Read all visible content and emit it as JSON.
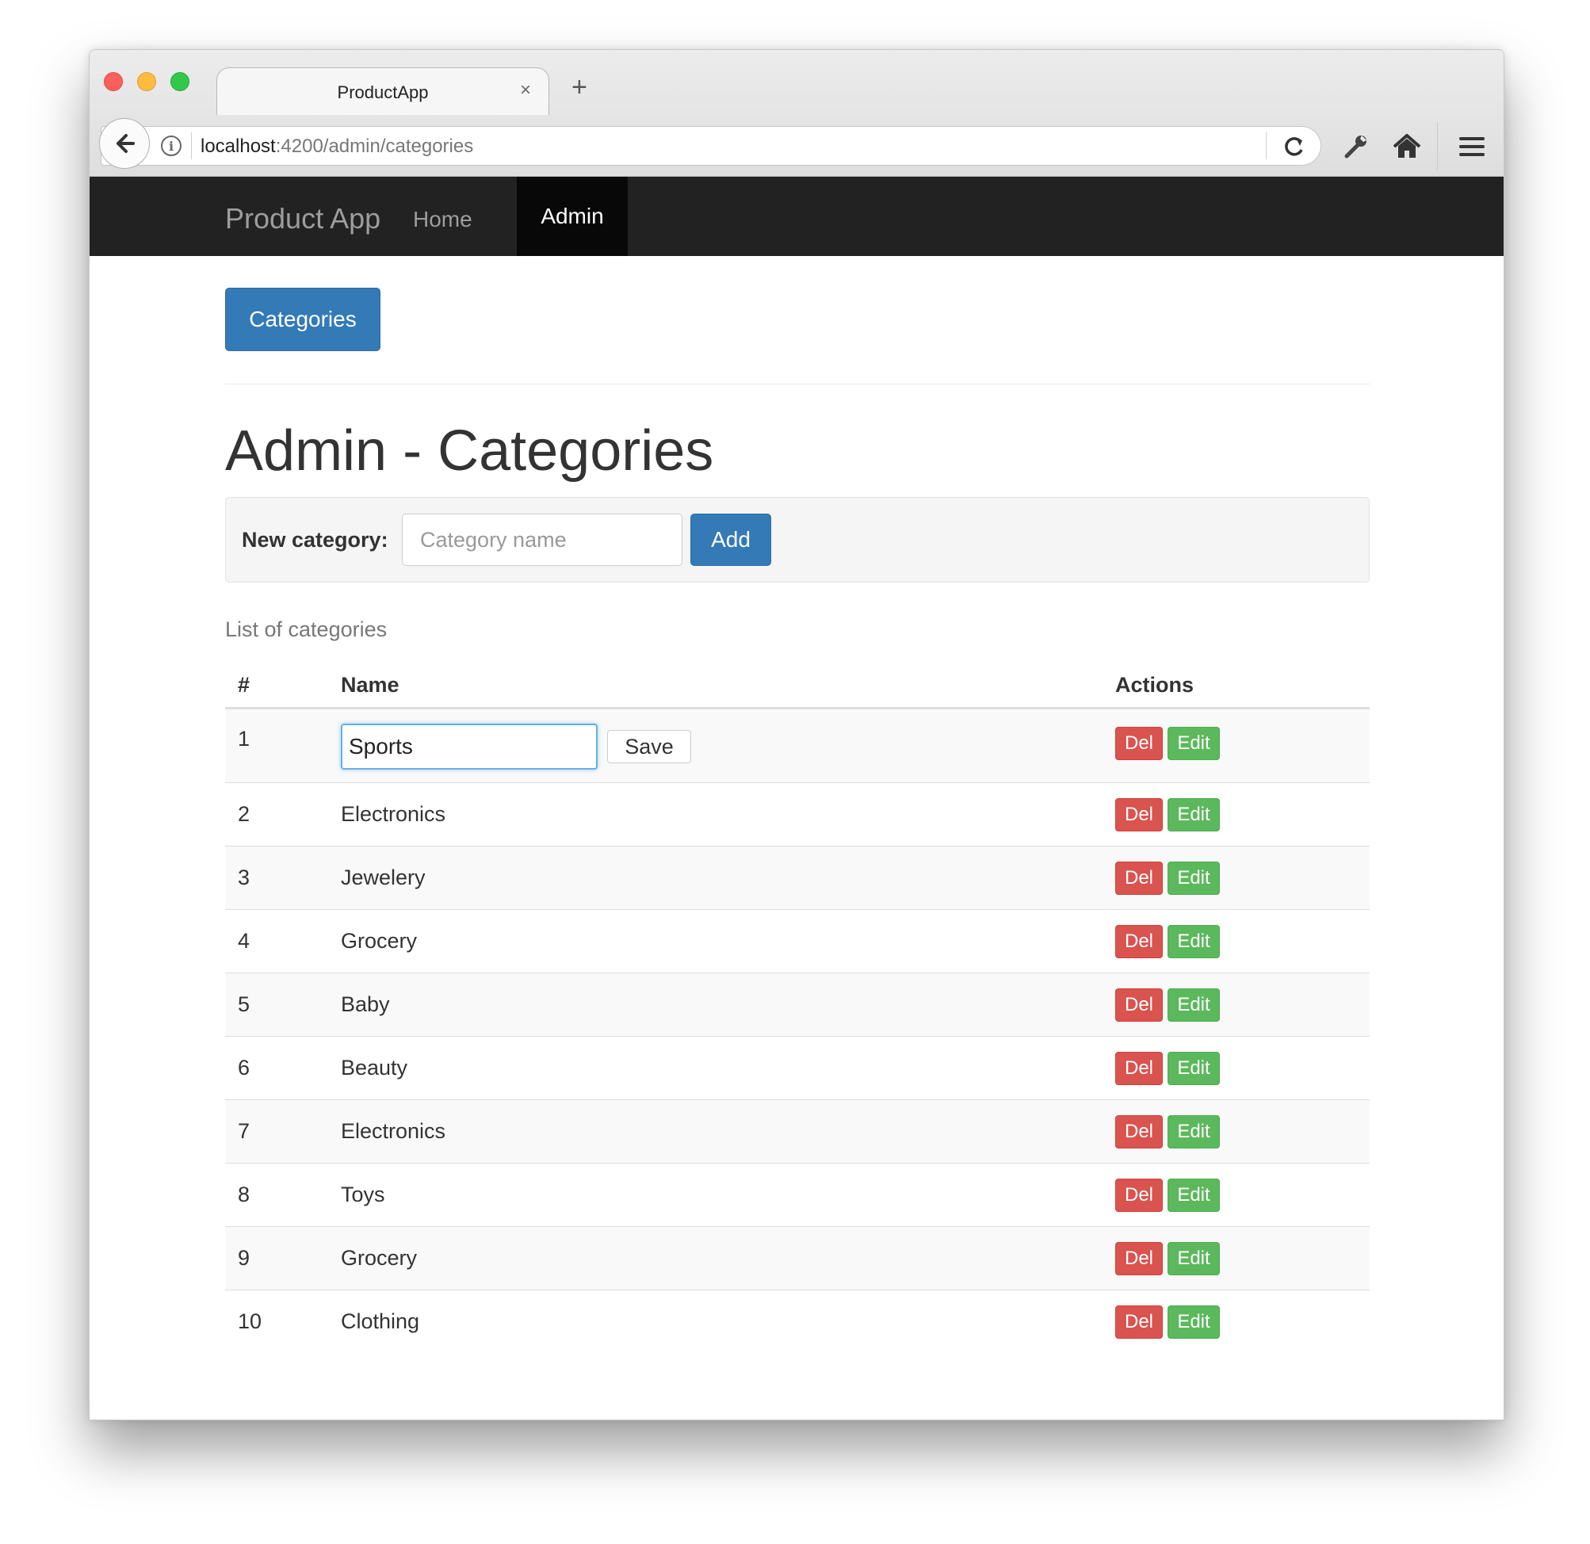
{
  "browser": {
    "tab_title": "ProductApp",
    "tab_close": "×",
    "new_tab": "+",
    "url_host": "localhost",
    "url_path": ":4200/admin/categories"
  },
  "navbar": {
    "brand": "Product App",
    "items": [
      {
        "label": "Home",
        "active": false
      },
      {
        "label": "Admin",
        "active": true
      }
    ]
  },
  "main": {
    "categories_button": "Categories",
    "title": "Admin - Categories",
    "form": {
      "label": "New category:",
      "placeholder": "Category name",
      "value": "",
      "add_button": "Add"
    },
    "caption": "List of categories",
    "table": {
      "headers": [
        "#",
        "Name",
        "Actions"
      ],
      "rows": [
        {
          "num": "1",
          "name": "Sports",
          "editing": true
        },
        {
          "num": "2",
          "name": "Electronics"
        },
        {
          "num": "3",
          "name": "Jewelery"
        },
        {
          "num": "4",
          "name": "Grocery"
        },
        {
          "num": "5",
          "name": "Baby"
        },
        {
          "num": "6",
          "name": "Beauty"
        },
        {
          "num": "7",
          "name": "Electronics"
        },
        {
          "num": "8",
          "name": "Toys"
        },
        {
          "num": "9",
          "name": "Grocery"
        },
        {
          "num": "10",
          "name": "Clothing"
        }
      ],
      "save_label": "Save",
      "del_label": "Del",
      "edit_label": "Edit"
    }
  },
  "colors": {
    "primary": "#337ab7",
    "danger": "#d9534f",
    "success": "#5cb85c",
    "navbar": "#222222"
  }
}
